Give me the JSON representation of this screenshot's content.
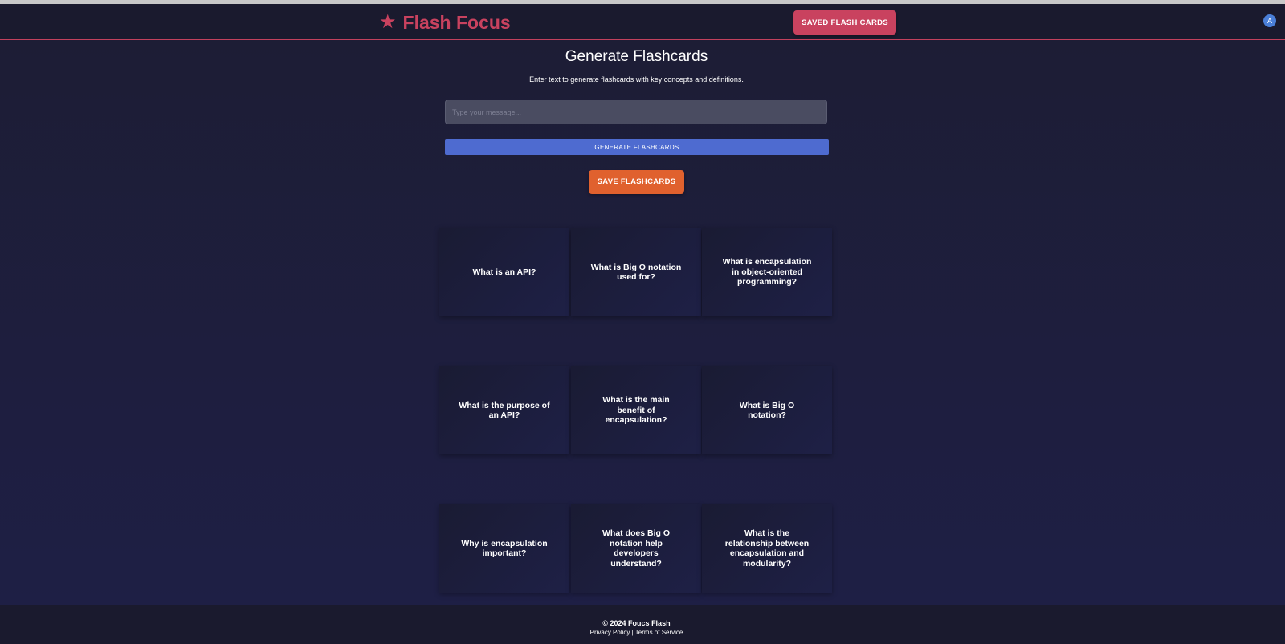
{
  "header": {
    "logo_icon": "star-icon",
    "brand": "Flash Focus",
    "saved_button": "SAVED FLASH CARDS",
    "avatar_initial": "A"
  },
  "main": {
    "title": "Generate Flashcards",
    "subtitle": "Enter text to generate flashcards with key concepts and definitions.",
    "input_placeholder": "Type your message...",
    "input_value": "",
    "generate_button": "GENERATE FLASHCARDS",
    "save_button": "SAVE FLASHCARDS"
  },
  "cards": [
    "What is an API?",
    "What is Big O notation used for?",
    "What is encapsulation in object-oriented programming?",
    "What is the purpose of an API?",
    "What is the main benefit of encapsulation?",
    "What is Big O notation?",
    "Why is encapsulation important?",
    "What does Big O notation help developers understand?",
    "What is the relationship between encapsulation and modularity?"
  ],
  "footer": {
    "copyright": "© 2024 Foucs Flash",
    "privacy": "Privacy Policy",
    "separator": "|",
    "terms": "Terms of Service"
  },
  "colors": {
    "brand": "#c9425f",
    "generate": "#4e6bd0",
    "save": "#e0612e",
    "background": "#1c1c34"
  }
}
